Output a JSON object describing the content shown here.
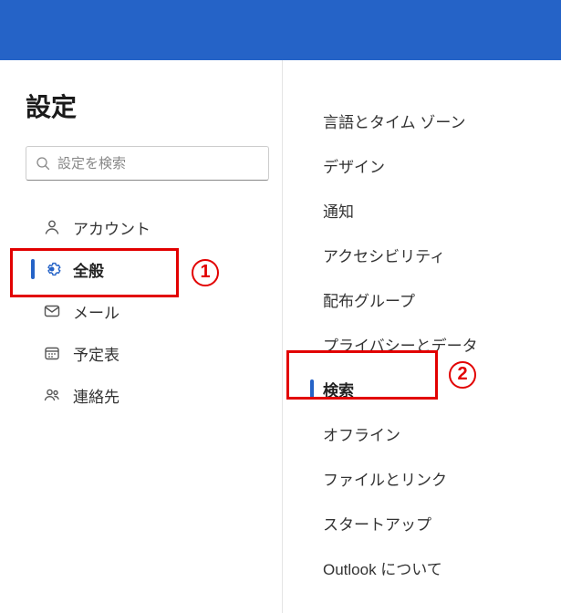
{
  "page": {
    "title": "設定",
    "search_placeholder": "設定を検索"
  },
  "nav": [
    {
      "id": "account",
      "label": "アカウント",
      "icon": "person",
      "selected": false
    },
    {
      "id": "general",
      "label": "全般",
      "icon": "gear",
      "selected": true
    },
    {
      "id": "mail",
      "label": "メール",
      "icon": "envelope",
      "selected": false
    },
    {
      "id": "calendar",
      "label": "予定表",
      "icon": "calendar",
      "selected": false
    },
    {
      "id": "contacts",
      "label": "連絡先",
      "icon": "people",
      "selected": false
    }
  ],
  "sub": [
    {
      "id": "lang",
      "label": "言語とタイム ゾーン",
      "selected": false
    },
    {
      "id": "design",
      "label": "デザイン",
      "selected": false
    },
    {
      "id": "notif",
      "label": "通知",
      "selected": false
    },
    {
      "id": "access",
      "label": "アクセシビリティ",
      "selected": false
    },
    {
      "id": "dist",
      "label": "配布グループ",
      "selected": false
    },
    {
      "id": "privacy",
      "label": "プライバシーとデータ",
      "selected": false
    },
    {
      "id": "search",
      "label": "検索",
      "selected": true
    },
    {
      "id": "offline",
      "label": "オフライン",
      "selected": false
    },
    {
      "id": "files",
      "label": "ファイルとリンク",
      "selected": false
    },
    {
      "id": "startup",
      "label": "スタートアップ",
      "selected": false
    },
    {
      "id": "about",
      "label": "Outlook について",
      "selected": false
    }
  ],
  "markers": {
    "one": "1",
    "two": "2"
  }
}
